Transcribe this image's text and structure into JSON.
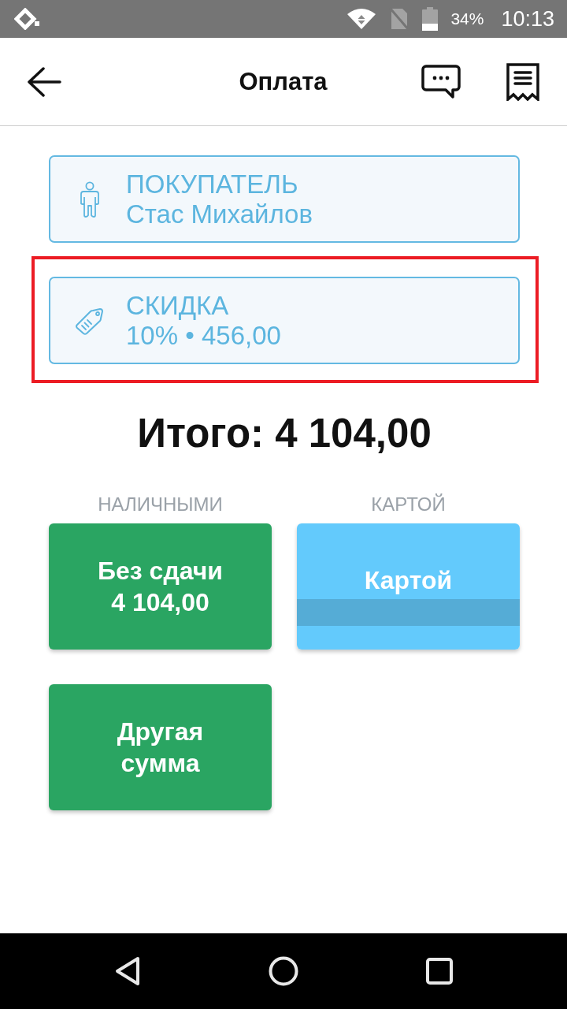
{
  "status_bar": {
    "battery": "34%",
    "time": "10:13"
  },
  "header": {
    "title": "Оплата"
  },
  "info_cards": [
    {
      "kind": "customer",
      "label": "ПОКУПАТЕЛЬ",
      "value": "Стас Михайлов",
      "highlighted": false
    },
    {
      "kind": "discount",
      "label": "СКИДКА",
      "value": "10% • 456,00",
      "highlighted": true
    }
  ],
  "total": "Итого: 4 104,00",
  "payment_groups": [
    {
      "heading": "НАЛИЧНЫМИ",
      "buttons": [
        {
          "kind": "cash",
          "lines": [
            "Без сдачи",
            "4 104,00"
          ]
        },
        {
          "kind": "cash",
          "lines": [
            "Другая",
            "сумма"
          ]
        }
      ]
    },
    {
      "heading": "КАРТОЙ",
      "buttons": [
        {
          "kind": "card",
          "lines": [
            "Картой"
          ]
        }
      ]
    }
  ]
}
